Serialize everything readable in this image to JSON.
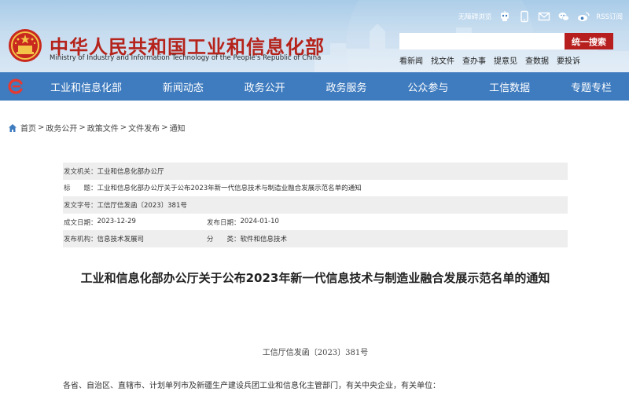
{
  "header": {
    "site_title": "中华人民共和国工业和信息化部",
    "site_subtitle": "Ministry of Industry and Information Technology of the People's Republic of China",
    "accessible_label": "无障碍浏览",
    "rss_label": "RSS订阅",
    "search_placeholder": "",
    "search_button": "统一搜索",
    "quick_links": [
      "看新闻",
      "找文件",
      "查办事",
      "提意见",
      "查数据",
      "要投诉"
    ]
  },
  "nav": {
    "items": [
      "工业和信息化部",
      "新闻动态",
      "政务公开",
      "政务服务",
      "公众参与",
      "工信数据",
      "专题专栏"
    ]
  },
  "breadcrumb": {
    "items": [
      "首页",
      "政务公开",
      "政策文件",
      "文件发布",
      "通知"
    ],
    "separator": ">"
  },
  "meta": {
    "issuer_label": "发文机关：",
    "issuer": "工业和信息化部办公厅",
    "title_label": "标　　题：",
    "title": "工业和信息化部办公厅关于公布2023年新一代信息技术与制造业融合发展示范名单的通知",
    "docno_label": "发文字号：",
    "docno": "工信厅信发函〔2023〕381号",
    "created_label": "成文日期：",
    "created": "2023-12-29",
    "published_label": "发布日期：",
    "published": "2024-01-10",
    "org_label": "发布机构：",
    "org": "信息技术发展司",
    "category_label": "分　　类：",
    "category": "软件和信息技术"
  },
  "article": {
    "title": "工业和信息化部办公厅关于公布2023年新一代信息技术与制造业融合发展示范名单的通知",
    "doc_number": "工信厅信发函〔2023〕381号",
    "salutation": "各省、自治区、直辖市、计划单列市及新疆生产建设兵团工业和信息化主管部门，有关中央企业，有关单位："
  },
  "colors": {
    "brand_red": "#b5231b",
    "nav_blue": "#3e7bbf",
    "search_button": "#b71f1f"
  }
}
